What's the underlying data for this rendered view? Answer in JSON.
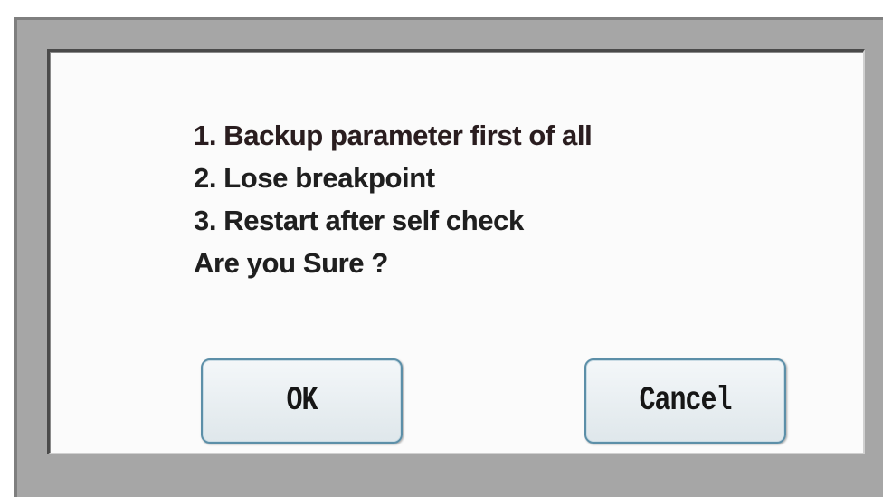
{
  "dialog": {
    "message_lines": [
      "1. Backup parameter first of all",
      "2. Lose breakpoint",
      "3. Restart after self check",
      "Are you Sure ?"
    ],
    "buttons": {
      "ok_label": "OK",
      "cancel_label": "Cancel"
    }
  },
  "colors": {
    "frame": "#a6a6a6",
    "panel": "#fbfbfb",
    "button_border": "#5c8fa8",
    "text": "#1f1f1f"
  }
}
